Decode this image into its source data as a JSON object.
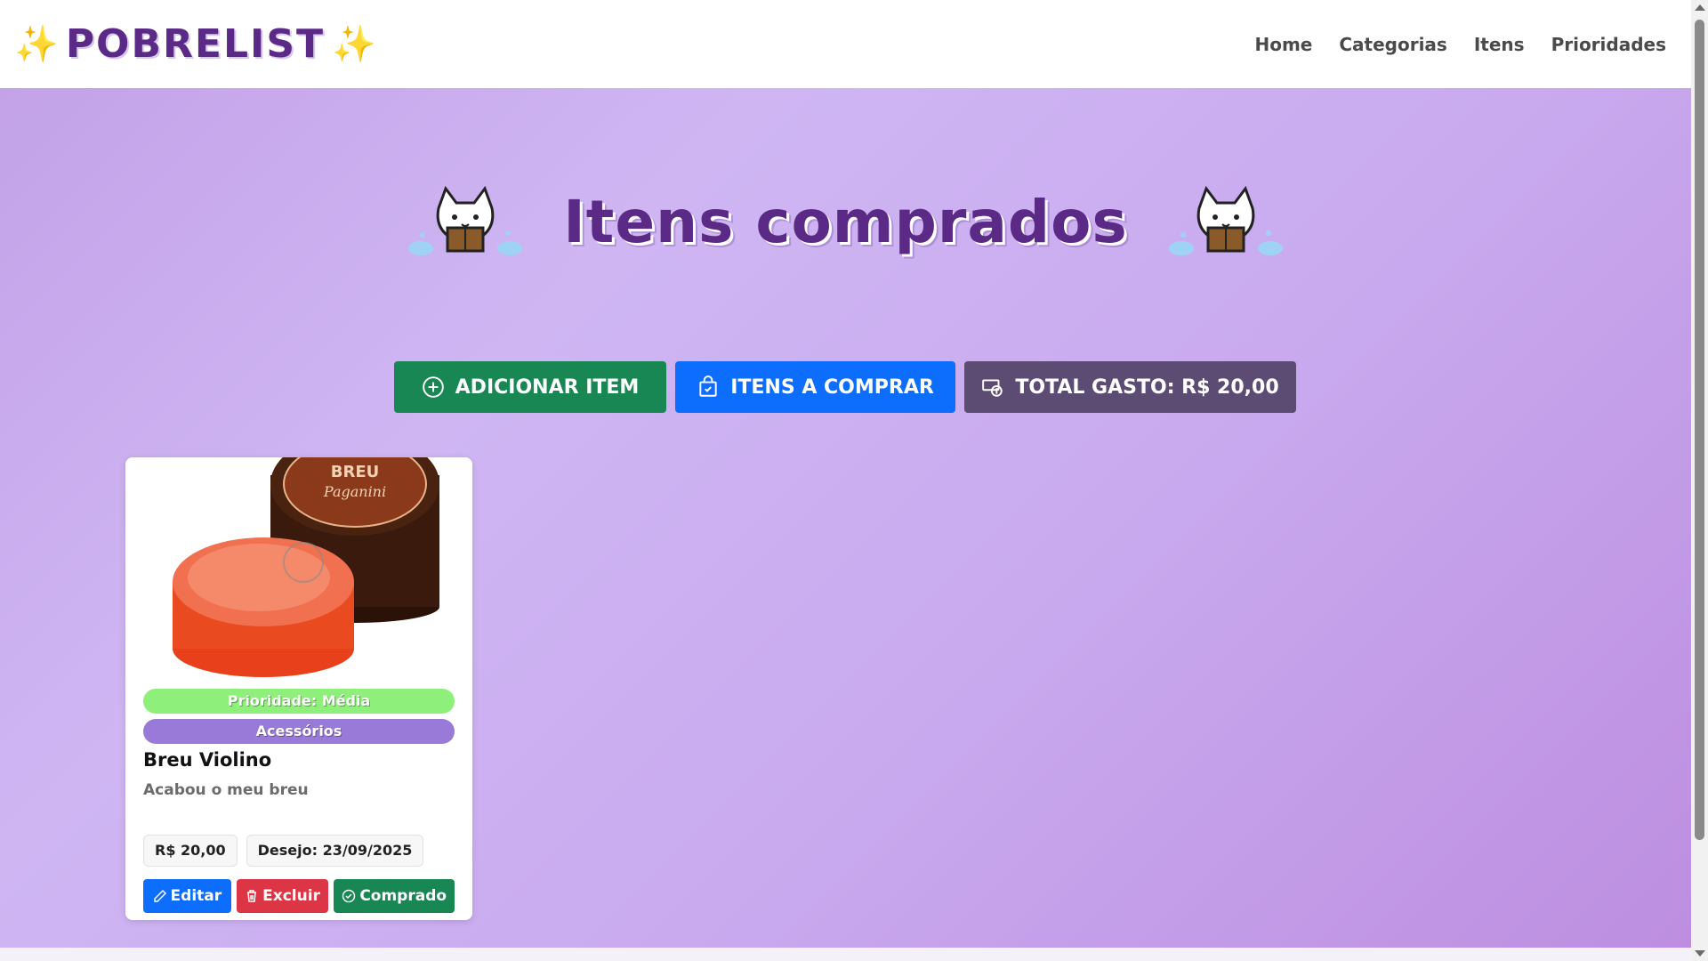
{
  "brand": {
    "text": "POBRELIST",
    "sparkle": "✨"
  },
  "nav": {
    "items": [
      {
        "label": "Home"
      },
      {
        "label": "Categorias"
      },
      {
        "label": "Itens"
      },
      {
        "label": "Prioridades"
      }
    ]
  },
  "page": {
    "title": "Itens comprados"
  },
  "actions": {
    "add_label": "ADICIONAR ITEM",
    "to_buy_label": "ITENS A COMPRAR",
    "total_label": "TOTAL GASTO: R$ 20,00"
  },
  "card": {
    "image_text": "BREU Paganini",
    "priority": "Prioridade: Média",
    "category": "Acessórios",
    "name": "Breu Violino",
    "description": "Acabou o meu breu",
    "price": "R$ 20,00",
    "wish_date": "Desejo: 23/09/2025",
    "edit_label": "Editar",
    "delete_label": "Excluir",
    "bought_label": "Comprado"
  },
  "colors": {
    "brand_purple": "#5b2a86",
    "green": "#198754",
    "blue": "#0d6efd",
    "dark": "#5c4b73",
    "red": "#dc3545",
    "priority_green": "#8ef07a",
    "category_purple": "#9a7ad9"
  },
  "icons": {
    "add": "plus-circle-icon",
    "to_buy": "bag-check-icon",
    "total": "cash-coin-icon",
    "edit": "pencil-icon",
    "delete": "trash-icon",
    "bought": "check-circle-icon",
    "decoration": "cat-reading-icon"
  }
}
